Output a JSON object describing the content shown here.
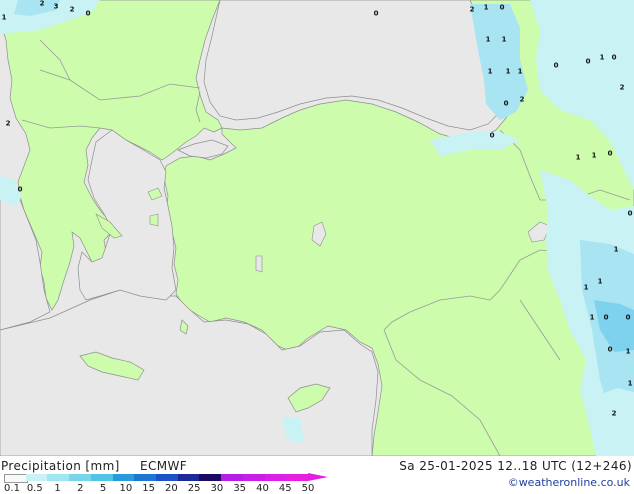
{
  "map": {
    "precip_labels": [
      "2",
      "3",
      "2",
      "0",
      "2",
      "1",
      "0",
      "1",
      "1",
      "1",
      "1",
      "1",
      "0",
      "0",
      "1",
      "0",
      "2",
      "0",
      "2",
      "0",
      "1",
      "1",
      "0",
      "0",
      "2",
      "0",
      "1",
      "1",
      "1",
      "1",
      "0",
      "0",
      "0",
      "1",
      "2",
      "1",
      "0",
      "1"
    ]
  },
  "legend": {
    "title": "Precipitation [mm]",
    "model": "ECMWF",
    "ticks": [
      "0.1",
      "0.5",
      "1",
      "2",
      "5",
      "10",
      "15",
      "20",
      "25",
      "30",
      "35",
      "40",
      "45",
      "50"
    ],
    "colors": [
      "#f5fafa",
      "#c8f2f5",
      "#a0e6f0",
      "#78d6eb",
      "#50c3e6",
      "#289bdc",
      "#1e78d2",
      "#1e50c8",
      "#1e2896",
      "#1e0a64",
      "#b41ee6",
      "#c81ee6",
      "#dc1ee6",
      "#e61ee1",
      "#e61ec8"
    ]
  },
  "valid_time": "Sa 25-01-2025 12..18 UTC (12+246)",
  "credit": "©weatheronline.co.uk",
  "colors": {
    "land": "#ccfcac",
    "sea": "#e8e8e8",
    "border": "#9a9a9a",
    "precip_light": "#c9f2f5",
    "precip_mid": "#a8e4f2",
    "precip_strong": "#7fd2ee"
  }
}
